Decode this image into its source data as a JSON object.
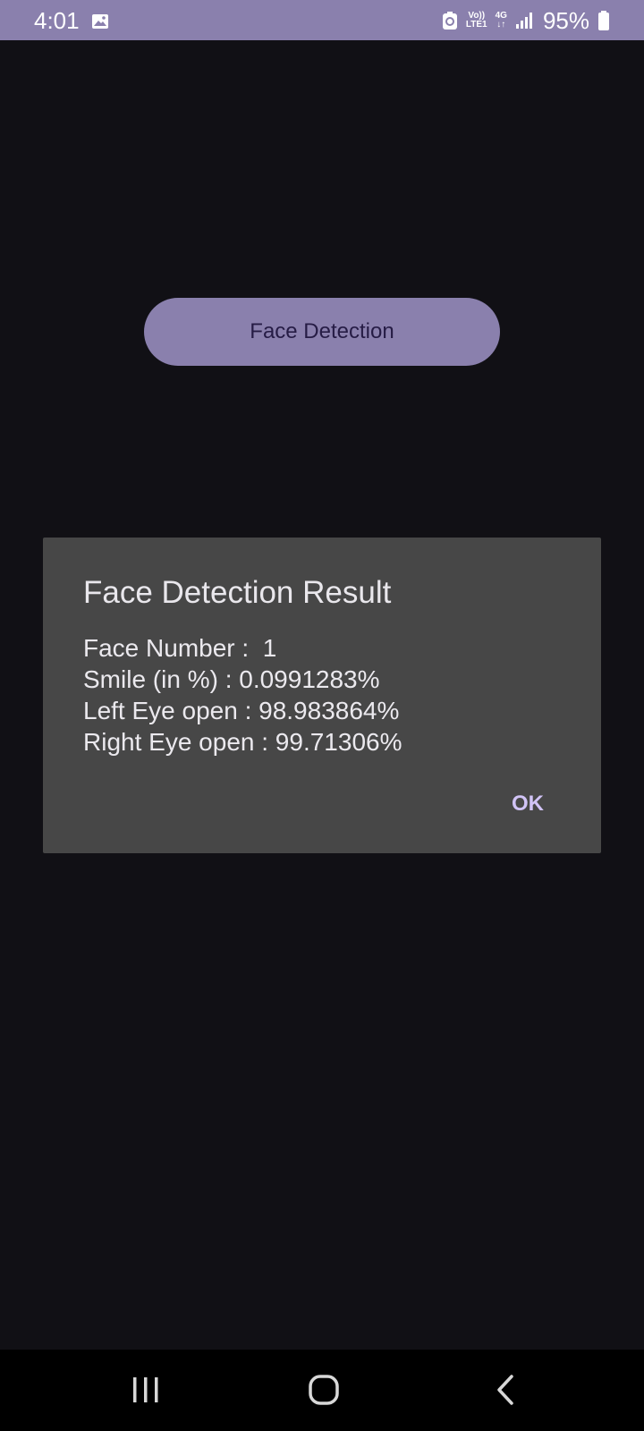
{
  "status_bar": {
    "time": "4:01",
    "volte": "Vo))",
    "lte": "LTE1",
    "network_type": "4G",
    "battery_percent": "95%",
    "icons": [
      "gallery-icon",
      "data-saver-icon",
      "signal-icon",
      "battery-icon"
    ]
  },
  "main": {
    "button_label": "Face Detection"
  },
  "dialog": {
    "title": "Face Detection Result",
    "message": "Face Number :  1\nSmile (in %) : 0.0991283%\nLeft Eye open : 98.983864%\nRight Eye open : 99.71306%",
    "ok_label": "OK"
  },
  "nav_bar": {
    "icons": [
      "recents-icon",
      "home-icon",
      "back-icon"
    ]
  },
  "colors": {
    "status_bar_bg": "#8a80ad",
    "background": "#111015",
    "button_bg": "#8a80ad",
    "button_text": "#261c45",
    "dialog_bg": "#474747",
    "accent": "#d1c3f6"
  }
}
